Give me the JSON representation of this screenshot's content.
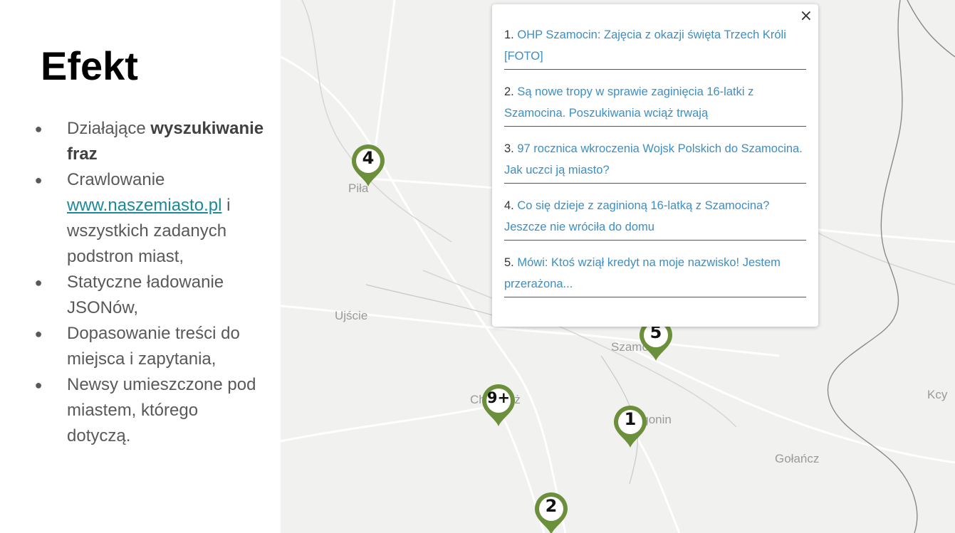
{
  "slide": {
    "title": "Efekt",
    "bullets": [
      {
        "pre": "Działające ",
        "bold": "wyszukiwanie fraz"
      },
      {
        "pre": "Crawlowanie ",
        "link": "www.naszemiasto.pl",
        "post": " i wszystkich zadanych podstron miast,"
      },
      {
        "pre": "Statyczne ładowanie JSONów,"
      },
      {
        "pre": "Dopasowanie treści do miejsca i zapytania,"
      },
      {
        "pre": "Newsy umieszczone pod miastem, którego dotyczą."
      }
    ],
    "link_color": "#1a8a9a"
  },
  "map": {
    "cities": {
      "pila": "Piła",
      "ujscie": "Ujście",
      "szamocin": "Szamocin",
      "chodziez": "Chodzież",
      "margonin": "Margonin",
      "golancz": "Gołańcz",
      "kcynia": "Kcy"
    },
    "markers": {
      "pila": "4",
      "szamocin": "5",
      "chodziez": "9+",
      "margonin": "1",
      "bottom": "2"
    },
    "marker_color": "#6b8f3a"
  },
  "popup": {
    "close": "×",
    "items": [
      {
        "n": "1. ",
        "text": "OHP Szamocin: Zajęcia z okazji święta Trzech Króli [FOTO]"
      },
      {
        "n": "2. ",
        "text": "Są nowe tropy w sprawie zaginięcia 16-latki z Szamocina. Poszukiwania wciąż trwają"
      },
      {
        "n": "3. ",
        "text": "97 rocznica wkroczenia Wojsk Polskich do Szamocina. Jak uczci ją miasto?"
      },
      {
        "n": "4. ",
        "text": "Co się dzieje z zaginioną 16-latką z Szamocina? Jeszcze nie wróciła do domu"
      },
      {
        "n": "5. ",
        "text": "Mówi: Ktoś wziął kredyt na moje nazwisko! Jestem przerażona..."
      }
    ],
    "link_color": "#3b8fc4"
  }
}
